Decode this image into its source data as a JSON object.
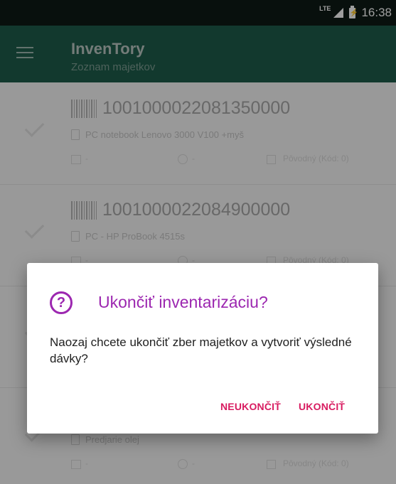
{
  "status_bar": {
    "network": "LTE",
    "time": "16:38"
  },
  "app_bar": {
    "title": "InvenTory",
    "subtitle": "Zoznam majetkov"
  },
  "items": [
    {
      "code": "1001000022081350000",
      "description": "PC notebook Lenovo 3000 V100 +myš",
      "date": "-",
      "time": "-",
      "status": "Pôvodný (Kód: 0)"
    },
    {
      "code": "1001000022084900000",
      "description": "PC - HP ProBook 4515s",
      "date": "-",
      "time": "-",
      "status": "Pôvodný (Kód: 0)"
    },
    {
      "code": "",
      "description": "",
      "date": "",
      "time": "",
      "status": ""
    },
    {
      "code": "",
      "description": "Predjarie olej",
      "date": "-",
      "time": "-",
      "status": "Pôvodný (Kód: 0)"
    }
  ],
  "dialog": {
    "icon": "help-circle-icon",
    "title": "Ukončiť inventarizáciu?",
    "message": "Naozaj chcete ukončiť zber majetkov a vytvoriť výsledné dávky?",
    "buttons": {
      "cancel": "NEUKONČIŤ",
      "confirm": "UKONČIŤ"
    }
  },
  "colors": {
    "app_bar": "#1d5c4b",
    "status_bar": "#0e1a16",
    "accent": "#9c27b0",
    "button": "#d81b60"
  }
}
